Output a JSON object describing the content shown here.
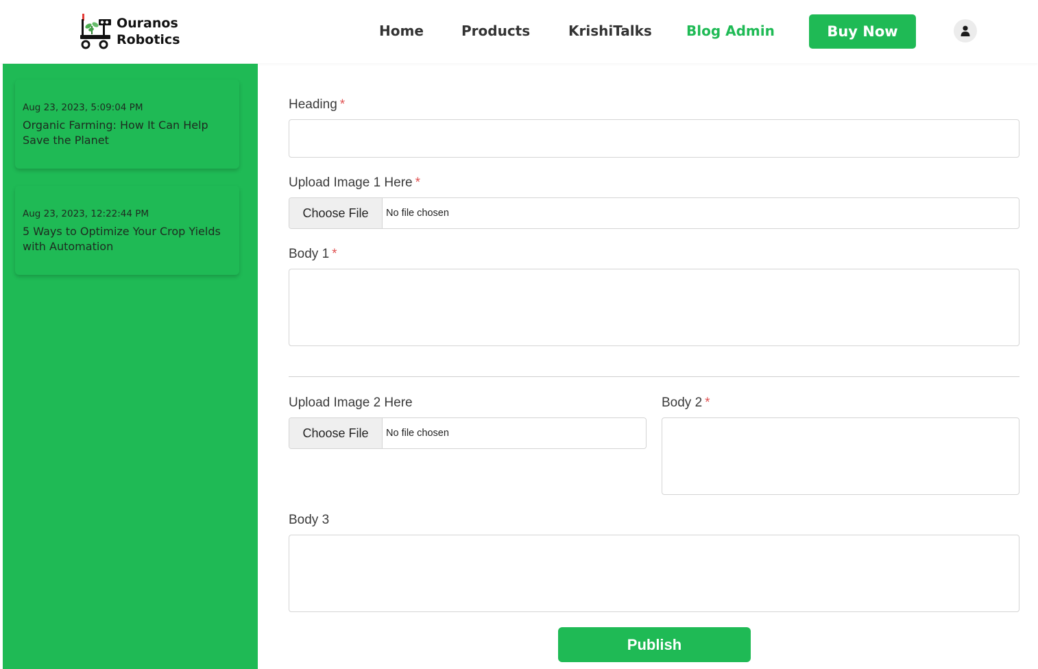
{
  "brand": {
    "name_line1": "Ouranos",
    "name_line2": "Robotics",
    "logo_icon": "farm-robot-icon",
    "accent_color": "#1fba55"
  },
  "nav": {
    "items": [
      {
        "label": "Home",
        "active": false
      },
      {
        "label": "Products",
        "active": false
      },
      {
        "label": "KrishiTalks",
        "active": false
      },
      {
        "label": "Blog Admin",
        "active": true
      }
    ],
    "cta_label": "Buy Now",
    "profile_icon": "user-icon"
  },
  "sidebar": {
    "posts": [
      {
        "date": "Aug 23, 2023, 5:09:04 PM",
        "title": "Organic Farming: How It Can Help Save the Planet"
      },
      {
        "date": "Aug 23, 2023, 12:22:44 PM",
        "title": "5 Ways to Optimize Your Crop Yields with Automation"
      }
    ]
  },
  "form": {
    "heading_label": "Heading",
    "heading_value": "",
    "image1_label": "Upload Image 1 Here",
    "image1_button": "Choose File",
    "image1_status": "No file chosen",
    "body1_label": "Body 1",
    "body1_value": "",
    "image2_label": "Upload Image 2 Here",
    "image2_button": "Choose File",
    "image2_status": "No file chosen",
    "body2_label": "Body 2",
    "body2_value": "",
    "body3_label": "Body 3",
    "body3_value": "",
    "required_mark": "*",
    "publish_label": "Publish"
  }
}
